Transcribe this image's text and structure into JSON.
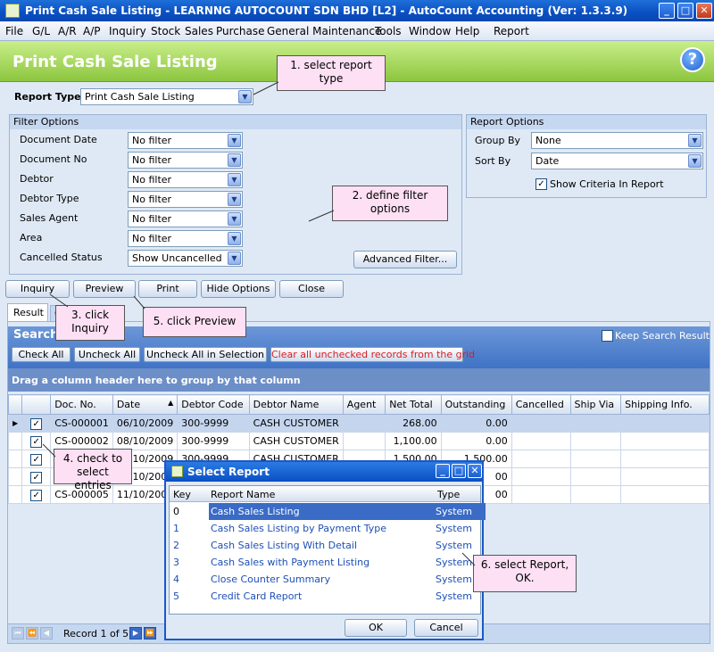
{
  "window": {
    "title": "Print Cash Sale Listing - LEARNNG AUTOCOUNT SDN BHD [L2] - AutoCount Accounting (Ver: 1.3.3.9)",
    "min": "_",
    "max": "□",
    "close": "✕"
  },
  "menu": [
    "File",
    "G/L",
    "A/R",
    "A/P",
    "Inquiry",
    "Stock",
    "Sales",
    "Purchase",
    "General Maintenance",
    "Tools",
    "Window",
    "Help",
    "Report"
  ],
  "header": {
    "title": "Print Cash Sale Listing",
    "help": "?"
  },
  "report_type": {
    "label": "Report Type",
    "value": "Print Cash Sale Listing"
  },
  "filter": {
    "title": "Filter Options",
    "rows": [
      {
        "label": "Document Date",
        "value": "No filter"
      },
      {
        "label": "Document No",
        "value": "No filter"
      },
      {
        "label": "Debtor",
        "value": "No filter"
      },
      {
        "label": "Debtor Type",
        "value": "No filter"
      },
      {
        "label": "Sales Agent",
        "value": "No filter"
      },
      {
        "label": "Area",
        "value": "No filter"
      },
      {
        "label": "Cancelled Status",
        "value": "Show Uncancelled"
      }
    ],
    "advanced": "Advanced Filter..."
  },
  "report_options": {
    "title": "Report Options",
    "group_by_label": "Group By",
    "group_by": "None",
    "sort_by_label": "Sort By",
    "sort_by": "Date",
    "show_criteria": "Show Criteria In Report"
  },
  "actions": [
    "Inquiry",
    "Preview",
    "Print",
    "Hide Options",
    "Close"
  ],
  "tabs": {
    "result": "Result",
    "other": "C"
  },
  "search": {
    "title": "Search",
    "keep": "Keep Search Result",
    "check_all": "Check All",
    "uncheck_all": "Uncheck All",
    "uncheck_sel": "Uncheck All in Selection",
    "clear": "Clear all unchecked records from the grid"
  },
  "grid": {
    "group_hint": "Drag a column header here to group by that column",
    "columns": [
      "",
      "",
      "Doc. No.",
      "Date",
      "Debtor Code",
      "Debtor Name",
      "Agent",
      "Net Total",
      "Outstanding",
      "Cancelled",
      "Ship Via",
      "Shipping Info."
    ],
    "sort_icon": "▲",
    "rows": [
      {
        "doc": "CS-000001",
        "date": "06/10/2009",
        "code": "300-9999",
        "name": "CASH CUSTOMER",
        "net": "268.00",
        "out": "0.00"
      },
      {
        "doc": "CS-000002",
        "date": "08/10/2009",
        "code": "300-9999",
        "name": "CASH CUSTOMER",
        "net": "1,100.00",
        "out": "0.00"
      },
      {
        "doc": "",
        "date": "10/2009",
        "code": "300-9999",
        "name": "CASH CUSTOMER",
        "net": "1,500.00",
        "out": "1,500.00"
      },
      {
        "doc": "",
        "date": "10/2009",
        "code": "",
        "name": "",
        "net": "",
        "out": "00"
      },
      {
        "doc": "CS-000005",
        "date": "11/10/200",
        "code": "",
        "name": "",
        "net": "",
        "out": "00"
      }
    ]
  },
  "nav": {
    "record": "Record 1 of 5"
  },
  "dialog": {
    "title": "Select Report",
    "cols": [
      "Key",
      "Report Name",
      "Type"
    ],
    "rows": [
      {
        "key": "0",
        "name": "Cash Sales Listing",
        "type": "System"
      },
      {
        "key": "1",
        "name": "Cash Sales Listing by Payment Type",
        "type": "System"
      },
      {
        "key": "2",
        "name": "Cash Sales Listing With Detail",
        "type": "System"
      },
      {
        "key": "3",
        "name": "Cash Sales with Payment Listing",
        "type": "System"
      },
      {
        "key": "4",
        "name": "Close Counter Summary",
        "type": "System"
      },
      {
        "key": "5",
        "name": "Credit Card Report",
        "type": "System"
      }
    ],
    "ok": "OK",
    "cancel": "Cancel"
  },
  "callouts": {
    "c1": "1. select report type",
    "c2": "2. define filter options",
    "c3": "3. click Inquiry",
    "c4": "4. check to select entries",
    "c5": "5. click Preview",
    "c6": "6. select Report, OK."
  }
}
